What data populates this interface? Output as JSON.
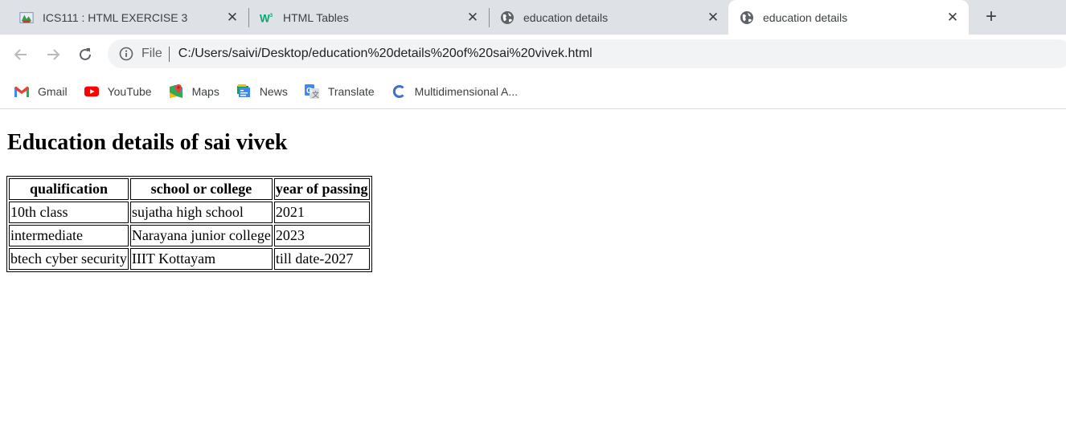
{
  "browser": {
    "tabs": [
      {
        "title": "ICS111 : HTML EXERCISE 3",
        "icon": "moodle-logo-icon"
      },
      {
        "title": "HTML Tables",
        "icon": "w3schools-icon"
      },
      {
        "title": "education details",
        "icon": "globe-icon"
      },
      {
        "title": "education details",
        "icon": "globe-icon",
        "active": true
      }
    ],
    "new_tab_label": "+",
    "omnibox": {
      "scheme": "File",
      "url": "C:/Users/saivi/Desktop/education%20details%20of%20sai%20vivek.html"
    },
    "bookmarks": [
      {
        "label": "Gmail",
        "icon": "gmail-icon"
      },
      {
        "label": "YouTube",
        "icon": "youtube-icon"
      },
      {
        "label": "Maps",
        "icon": "maps-icon"
      },
      {
        "label": "News",
        "icon": "news-icon"
      },
      {
        "label": "Translate",
        "icon": "translate-icon"
      },
      {
        "label": "Multidimensional A...",
        "icon": "c-logo-icon"
      }
    ]
  },
  "page": {
    "heading": "Education details of sai vivek",
    "table": {
      "headers": [
        "qualification",
        "school or college",
        "year of passing"
      ],
      "rows": [
        [
          "10th class",
          "sujatha high school",
          "2021"
        ],
        [
          "intermediate",
          "Narayana junior college",
          "2023"
        ],
        [
          "btech cyber security",
          "IIIT Kottayam",
          "till date-2027"
        ]
      ]
    }
  },
  "colors": {
    "tabstrip_bg": "#dee1e6",
    "omnibox_bg": "#f1f3f4",
    "text_dark": "#3c4043"
  }
}
